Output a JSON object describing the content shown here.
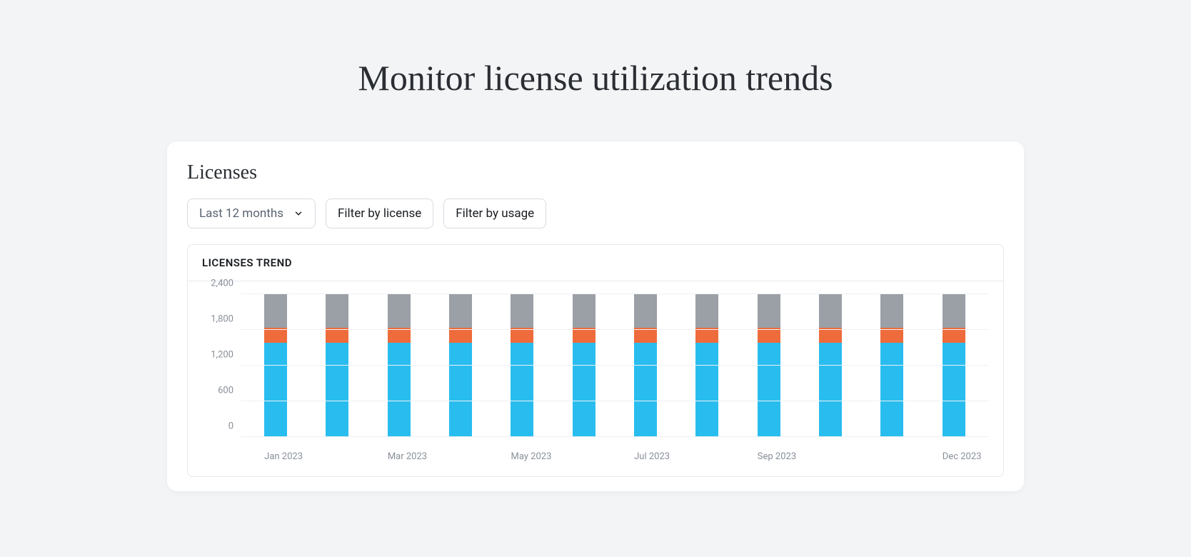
{
  "page": {
    "title": "Monitor license utilization trends"
  },
  "card": {
    "title": "Licenses"
  },
  "filters": {
    "range_select": {
      "label": "Last 12 months"
    },
    "filter_license": {
      "label": "Filter by license"
    },
    "filter_usage": {
      "label": "Filter by usage"
    }
  },
  "chart_panel": {
    "title": "LICENSES TREND"
  },
  "chart_data": {
    "type": "bar",
    "stacked": true,
    "title": "LICENSES TREND",
    "xlabel": "",
    "ylabel": "",
    "ylim": [
      0,
      2400
    ],
    "y_ticks": [
      0,
      600,
      1200,
      1800,
      2400
    ],
    "y_tick_labels": [
      "0",
      "600",
      "1,200",
      "1,800",
      "2,400"
    ],
    "categories": [
      "Jan 2023",
      "Feb 2023",
      "Mar 2023",
      "Apr 2023",
      "May 2023",
      "Jun 2023",
      "Jul 2023",
      "Aug 2023",
      "Sep 2023",
      "Oct 2023",
      "Nov 2023",
      "Dec 2023"
    ],
    "x_labels_visible": [
      "Jan 2023",
      "",
      "Mar 2023",
      "",
      "May 2023",
      "",
      "Jul 2023",
      "",
      "Sep 2023",
      "",
      "",
      "Dec 2023"
    ],
    "series": [
      {
        "name": "series-a",
        "color": "#29bdef",
        "values": [
          1580,
          1580,
          1580,
          1580,
          1580,
          1580,
          1580,
          1580,
          1580,
          1580,
          1580,
          1580
        ]
      },
      {
        "name": "series-b",
        "color": "#ee6b3b",
        "values": [
          260,
          260,
          260,
          260,
          260,
          260,
          260,
          260,
          260,
          260,
          260,
          260
        ]
      },
      {
        "name": "series-c",
        "color": "#9b9fa6",
        "values": [
          560,
          560,
          560,
          560,
          560,
          560,
          560,
          560,
          560,
          560,
          560,
          560
        ]
      }
    ]
  }
}
